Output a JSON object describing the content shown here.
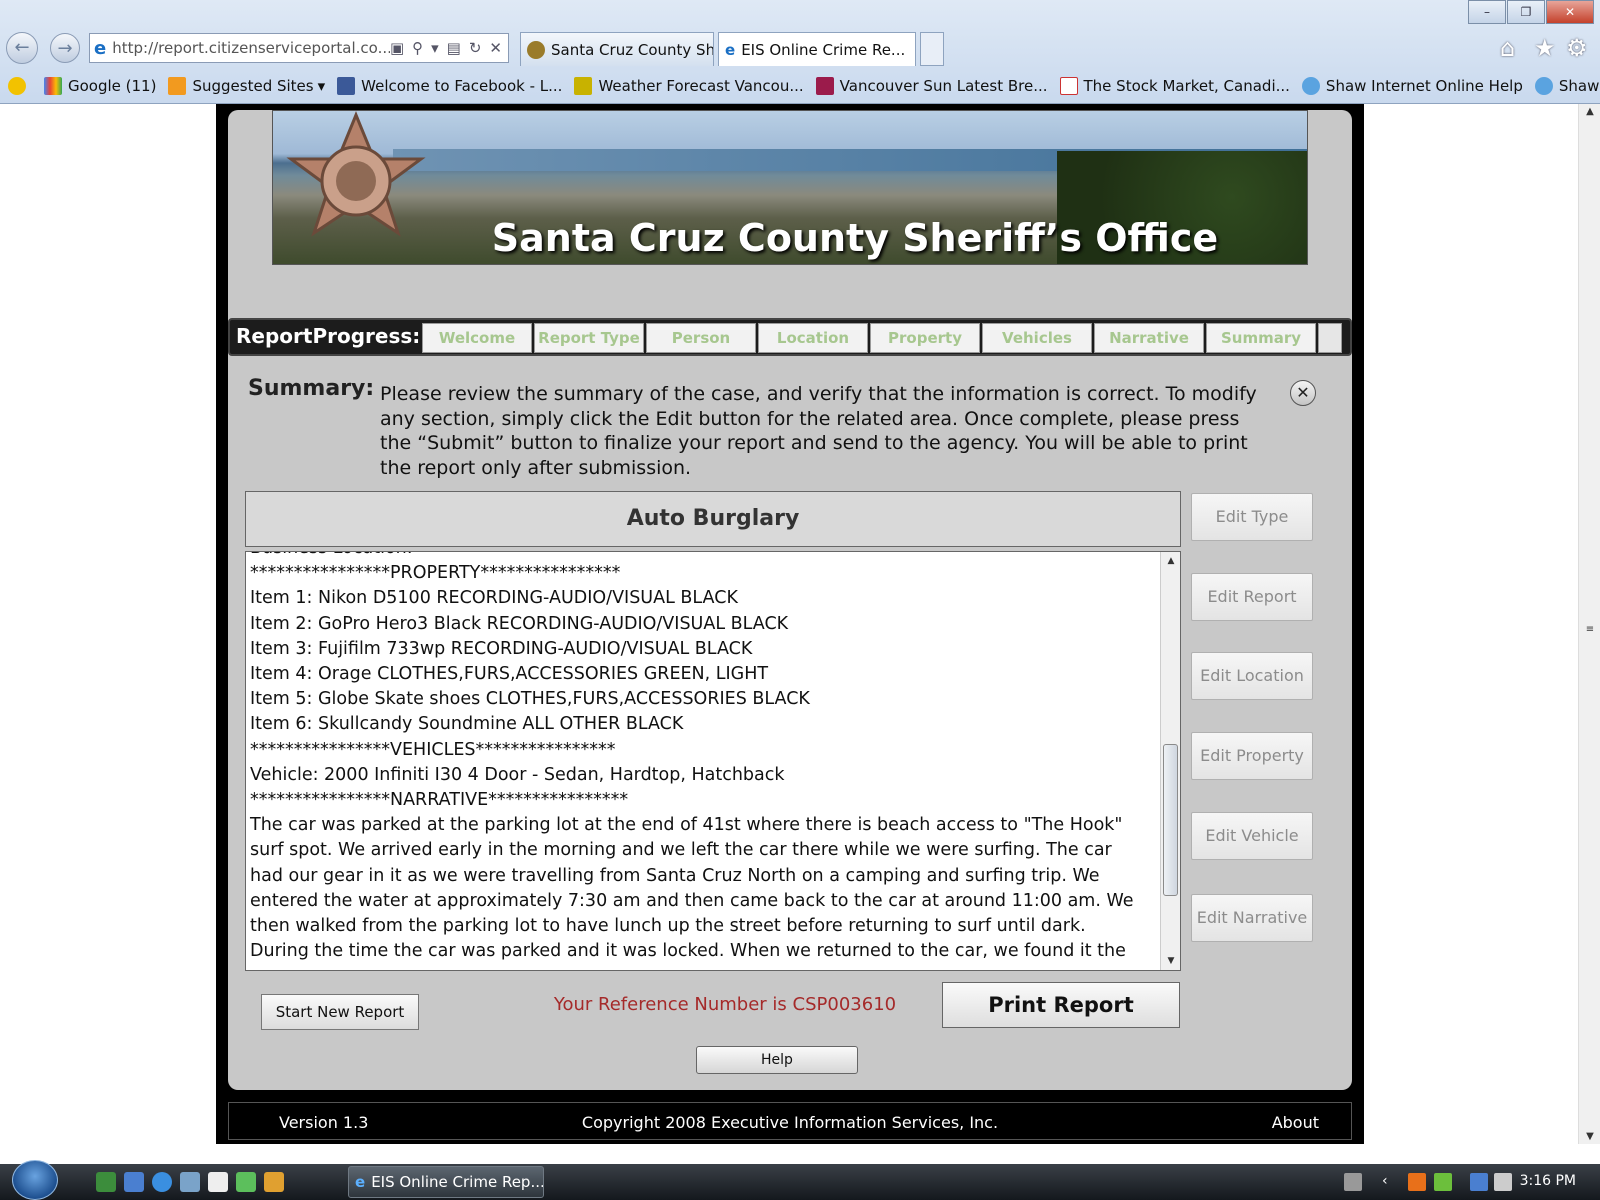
{
  "browser": {
    "address_url": "http://report.citizenserviceportal.co...",
    "tabs": [
      {
        "label": "Santa Cruz County Sher..."
      },
      {
        "label": "EIS Online Crime Re..."
      }
    ],
    "favorites": [
      {
        "label": "Google (11)"
      },
      {
        "label": "Suggested Sites"
      },
      {
        "label": "Welcome to Facebook - L..."
      },
      {
        "label": "Weather Forecast Vancou..."
      },
      {
        "label": "Vancouver Sun  Latest Bre..."
      },
      {
        "label": "The Stock Market, Canadi..."
      },
      {
        "label": "Shaw Internet Online Help"
      },
      {
        "label": "Shaw Support"
      }
    ]
  },
  "banner": {
    "title": "Santa Cruz County Sheriff’s Office"
  },
  "progress": {
    "label": "ReportProgress:",
    "steps": [
      "Welcome",
      "Report Type",
      "Person",
      "Location",
      "Property",
      "Vehicles",
      "Narrative",
      "Summary"
    ]
  },
  "summary": {
    "label": "Summary:",
    "instructions": "Please review the summary of the case, and verify that the information is correct.  To modify any section, simply click the Edit button for the related area. Once complete, please press the “Submit” button to finalize your report and send to the agency. You will be able to print the report only after submission."
  },
  "report": {
    "title": "Auto Burglary",
    "lines": [
      "Business Location:",
      "****************PROPERTY****************",
      "Item 1: Nikon D5100 RECORDING-AUDIO/VISUAL BLACK",
      "Item 2: GoPro Hero3 Black RECORDING-AUDIO/VISUAL BLACK",
      "Item 3: Fujifilm 733wp RECORDING-AUDIO/VISUAL BLACK",
      "Item 4: Orage  CLOTHES,FURS,ACCESSORIES GREEN, LIGHT",
      "Item 5: Globe Skate shoes CLOTHES,FURS,ACCESSORIES BLACK",
      "Item 6: Skullcandy Soundmine ALL OTHER BLACK",
      "****************VEHICLES****************",
      "Vehicle: 2000 Infiniti I30 4 Door - Sedan, Hardtop, Hatchback",
      "****************NARRATIVE****************",
      "The car was parked at the parking lot at the end of 41st where there is beach access to \"The Hook\"",
      "surf spot. We arrived early in the morning and we left the car there while we were surfing. The car",
      "had our gear in it as we were travelling from Santa Cruz North on a camping and surfing trip. We",
      "entered the water at approximately 7:30 am and then came back to the car at around 11:00 am. We",
      "then walked from the parking lot to have lunch up the street before returning to surf until dark.",
      "During the time the car was parked and it was locked. When we returned to the car, we found it the"
    ]
  },
  "edit_buttons": [
    "Edit Type",
    "Edit Report",
    "Edit Location",
    "Edit Property",
    "Edit Vehicle",
    "Edit Narrative"
  ],
  "actions": {
    "start_new": "Start New Report",
    "reference": "Your Reference Number is CSP003610",
    "print": "Print Report",
    "help": "Help"
  },
  "footer": {
    "version": "Version 1.3",
    "copyright": "Copyright 2008 Executive Information Services, Inc.",
    "about": "About"
  },
  "taskbar": {
    "window_label": "EIS Online Crime Rep...",
    "clock": "3:16 PM"
  },
  "colors": {
    "progress_step_text": "#a7c78f",
    "reference_text": "#a52a2a",
    "page_panel": "#c8c8c8"
  }
}
